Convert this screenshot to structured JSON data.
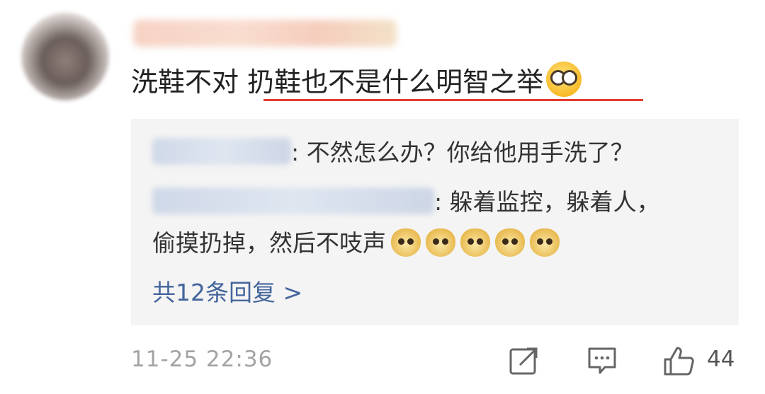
{
  "comment": {
    "text_plain": "洗鞋不对 ",
    "text_underlined": "扔鞋也不是什么明智之举",
    "emoji_icon": "glasses-face-icon"
  },
  "replies": [
    {
      "text": ": 不然怎么办？你给他用手洗了？"
    },
    {
      "text": ": 躲着监控，躲着人，",
      "text_cont": "偷摸扔掉，然后不吱声",
      "emoji_icons": [
        "doge-icon",
        "doge-icon",
        "doge-icon",
        "doge-icon",
        "doge-icon"
      ]
    }
  ],
  "more_replies_label": "共12条回复 >",
  "footer": {
    "timestamp": "11-25 22:36",
    "like_count": "44",
    "icons": [
      "share-icon",
      "comment-icon",
      "like-icon"
    ]
  },
  "colors": {
    "underline": "#e23b2e",
    "link": "#44659c",
    "reply_bg": "#f4f4f4",
    "meta": "#a3a3a3"
  }
}
